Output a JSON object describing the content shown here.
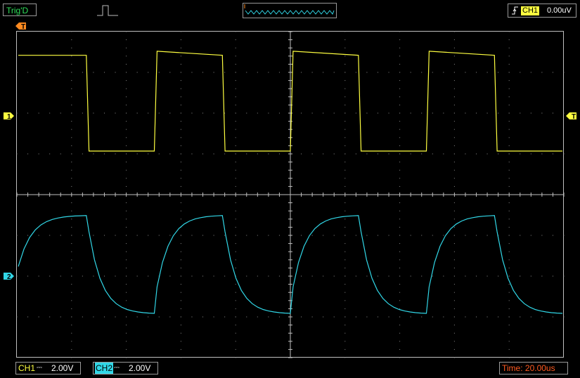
{
  "status": {
    "trigger_state": "Trig'D"
  },
  "trigger": {
    "source": "CH1",
    "level": "0.00uV",
    "marker_label": "T"
  },
  "channels": [
    {
      "id": "CH1",
      "marker_label": "1",
      "scale": "2.00V",
      "color": "#ffff40",
      "coupling": "DC"
    },
    {
      "id": "CH2",
      "marker_label": "2",
      "scale": "2.00V",
      "color": "#31d7e7",
      "coupling": "DC"
    }
  ],
  "timebase": {
    "label": "Time: 20.00us"
  },
  "icons": {
    "pulse": "pulse-icon",
    "memory_preview": "waveform-thumbnail-icon",
    "trigger_edge": "rising-edge-icon"
  },
  "chart_data": {
    "type": "line",
    "grid": true,
    "x_divisions": 10,
    "y_divisions": 8,
    "x_unit": "us",
    "y_unit": "V",
    "x": [
      0,
      25,
      26,
      50,
      51,
      75,
      76,
      100,
      101,
      125,
      126,
      150,
      151,
      175,
      176,
      200
    ],
    "series": [
      {
        "name": "CH1",
        "color": "#ffff40",
        "values": [
          5.0,
          5.0,
          0.3,
          0.3,
          5.2,
          5.0,
          0.3,
          0.3,
          5.2,
          5.0,
          0.3,
          0.3,
          5.2,
          5.0,
          0.3,
          0.3
        ]
      },
      {
        "name": "CH2",
        "color": "#31d7e7",
        "values": [
          2.5,
          5.0,
          4.2,
          0.2,
          1.5,
          5.0,
          4.2,
          0.2,
          1.5,
          5.0,
          4.2,
          0.2,
          1.5,
          5.0,
          4.2,
          0.2
        ]
      }
    ]
  }
}
